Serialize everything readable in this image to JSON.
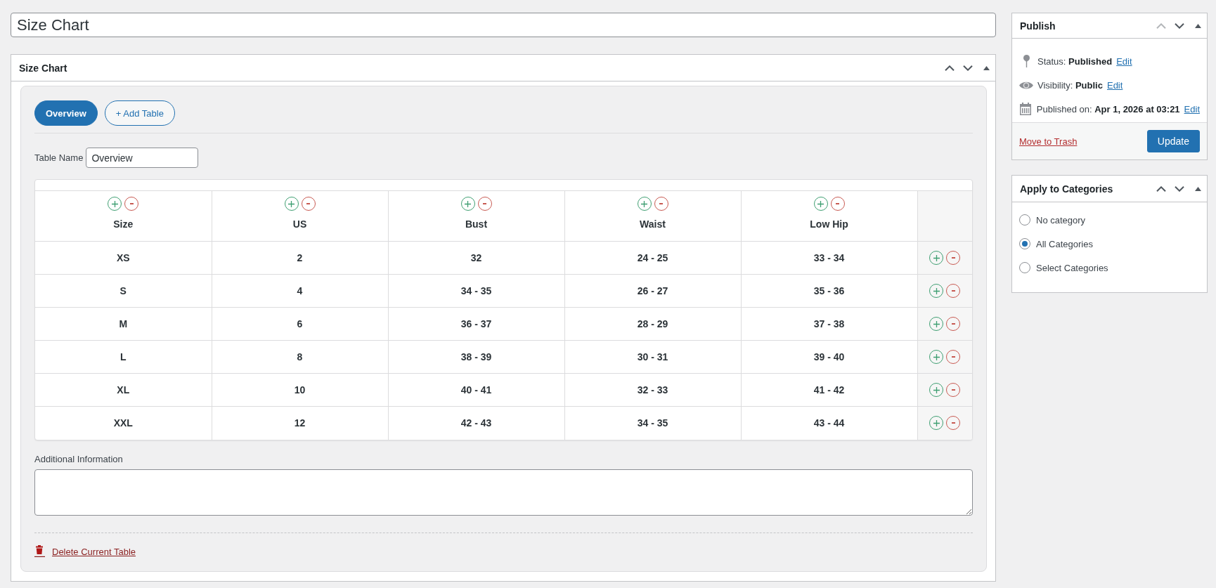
{
  "title_field": {
    "value": "Size Chart"
  },
  "size_chart": {
    "title": "Size Chart",
    "move_up_disabled": false,
    "tabs": [
      {
        "label": "Overview",
        "selected": true
      }
    ],
    "add_table_button": "+ Add Table",
    "table_name": {
      "label": "Table Name",
      "value": "Overview"
    },
    "table": {
      "columns": [
        "Size",
        "US",
        "Bust",
        "Waist",
        "Low Hip"
      ],
      "rows": [
        [
          "XS",
          "2",
          "32",
          "24 - 25",
          "33 - 34"
        ],
        [
          "S",
          "4",
          "34 - 35",
          "26 - 27",
          "35 - 36"
        ],
        [
          "M",
          "6",
          "36 - 37",
          "28 - 29",
          "37 - 38"
        ],
        [
          "L",
          "8",
          "38 - 39",
          "30 - 31",
          "39 - 40"
        ],
        [
          "XL",
          "10",
          "40 - 41",
          "32 - 33",
          "41 - 42"
        ],
        [
          "XXL",
          "12",
          "42 - 43",
          "34 - 35",
          "43 - 44"
        ]
      ]
    },
    "additional_information": {
      "label": "Additional Information"
    },
    "delete_link": "Delete Current Table"
  },
  "publish": {
    "title": "Publish",
    "move_up_disabled": true,
    "details": [
      {
        "kind": "status",
        "text": "Status: **Published**",
        "link": "Edit"
      },
      {
        "kind": "visibility",
        "text": "Visibility: **Public**",
        "link": "Edit"
      },
      {
        "kind": "date",
        "text": "Published on: **Apr 1, 2026 at 03:21**",
        "link": "Edit"
      }
    ],
    "trash_link": "Move to Trash",
    "update_button": "Update"
  },
  "categories": {
    "title": "Apply to Categories",
    "move_up_disabled": false,
    "options": [
      {
        "label": "No category",
        "selected": false
      },
      {
        "label": "All Categories",
        "selected": true
      },
      {
        "label": "Select Categories",
        "selected": false
      }
    ]
  }
}
